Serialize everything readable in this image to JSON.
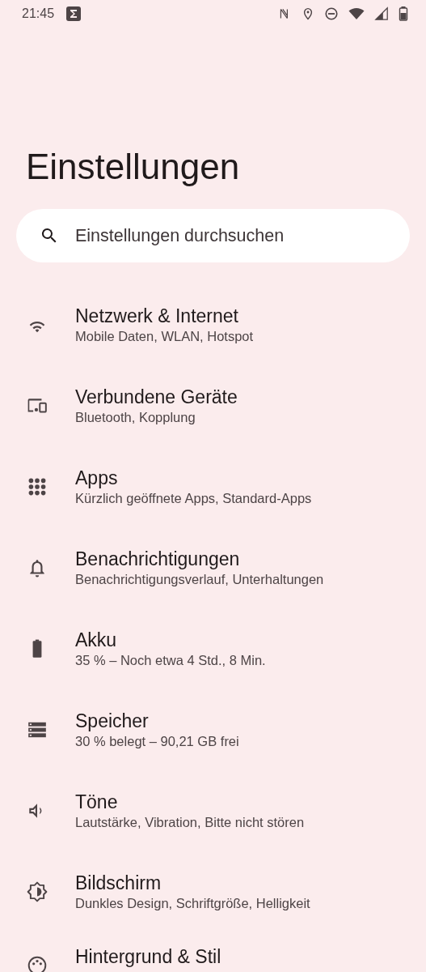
{
  "status_bar": {
    "time": "21:45",
    "icons": [
      {
        "kind": "sigma"
      },
      {
        "kind": "nfc"
      },
      {
        "kind": "location"
      },
      {
        "kind": "dnd"
      },
      {
        "kind": "wifi"
      },
      {
        "kind": "signal"
      },
      {
        "kind": "battery"
      }
    ]
  },
  "title": "Einstellungen",
  "search": {
    "placeholder": "Einstellungen durchsuchen"
  },
  "items": [
    {
      "kind": "wifi",
      "title": "Netzwerk & Internet",
      "subtitle": "Mobile Daten, WLAN, Hotspot"
    },
    {
      "kind": "devices",
      "title": "Verbundene Geräte",
      "subtitle": "Bluetooth, Kopplung"
    },
    {
      "kind": "apps",
      "title": "Apps",
      "subtitle": "Kürzlich geöffnete Apps, Standard-Apps"
    },
    {
      "kind": "bell",
      "title": "Benachrichtigungen",
      "subtitle": "Benachrichtigungsverlauf, Unterhaltungen"
    },
    {
      "kind": "battery",
      "title": "Akku",
      "subtitle": "35 % – Noch etwa 4 Std., 8 Min."
    },
    {
      "kind": "storage",
      "title": "Speicher",
      "subtitle": "30 % belegt – 90,21 GB frei"
    },
    {
      "kind": "volume",
      "title": "Töne",
      "subtitle": "Lautstärke, Vibration, Bitte nicht stören"
    },
    {
      "kind": "display",
      "title": "Bildschirm",
      "subtitle": "Dunkles Design, Schriftgröße, Helligkeit"
    },
    {
      "kind": "palette",
      "title": "Hintergrund & Stil"
    }
  ]
}
